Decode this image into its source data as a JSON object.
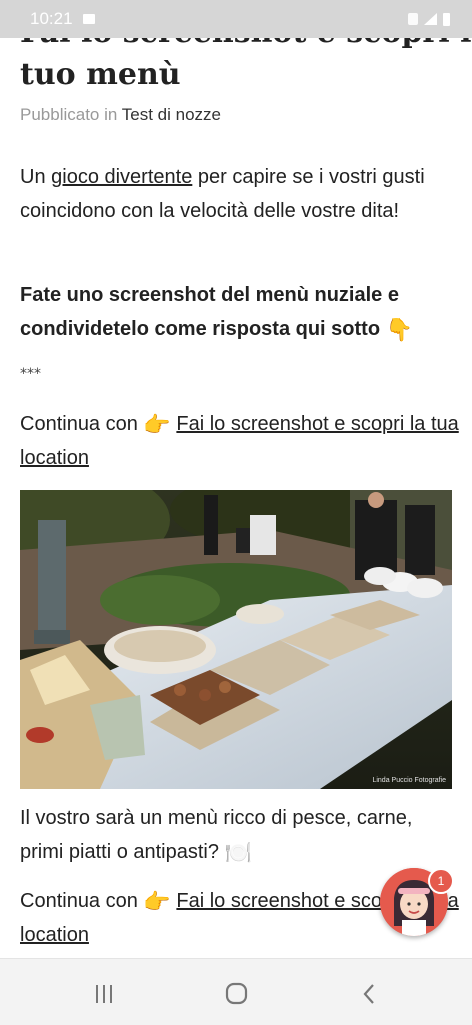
{
  "status": {
    "time": "10:21"
  },
  "article": {
    "title_cut": "Fai lo screenshot e scopri il",
    "title_line2": "tuo menù",
    "published_label": "Pubblicato in",
    "category": "Test di nozze"
  },
  "body": {
    "p1_before": "Un ",
    "p1_link": "gioco divertente",
    "p1_after": " per capire se i vostri gusti coincidono con la velocità delle vostre dita!",
    "p2_text": "Fate uno screenshot del menù nuziale e condividetelo come risposta qui sotto ",
    "p2_emoji": "👇",
    "stars": "***",
    "continua_label": "Continua con ",
    "continua_emoji": "👉",
    "continua_link": "Fai lo screenshot e scopri la tua location",
    "p4_text": "Il vostro sarà un menù ricco di pesce, carne, primi piatti o antipasti? ",
    "p4_emoji": "🍽️"
  },
  "photo": {
    "watermark": "Linda Puccio Fotografie"
  },
  "chat": {
    "badge_count": "1"
  }
}
